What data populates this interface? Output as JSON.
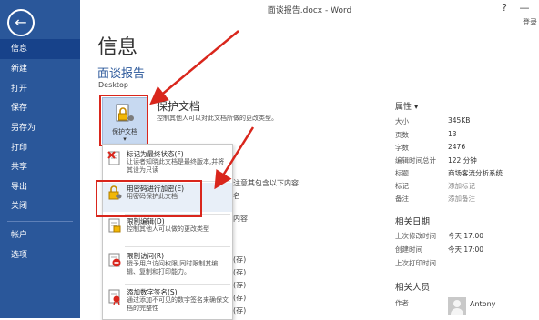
{
  "window": {
    "title": "面谈报告.docx - Word",
    "help": "?",
    "minimize": "—",
    "login": "登录"
  },
  "sidebar": {
    "back": "←",
    "items": [
      {
        "label": "信息"
      },
      {
        "label": "新建"
      },
      {
        "label": "打开"
      },
      {
        "label": "保存"
      },
      {
        "label": "另存为"
      },
      {
        "label": "打印"
      },
      {
        "label": "共享"
      },
      {
        "label": "导出"
      },
      {
        "label": "关闭"
      },
      {
        "label": "帐户"
      },
      {
        "label": "选项"
      }
    ]
  },
  "main": {
    "page_title": "信息",
    "doc_name": "面谈报告",
    "doc_path": "Desktop",
    "protect": {
      "button_label": "保护文档",
      "caret": "▾",
      "title": "保护文档",
      "desc": "控制其他人可以对此文档所做的更改类型。"
    },
    "bg_texts": {
      "a": "注意其包含以下内容:",
      "b": "名",
      "c": "内容",
      "d": "(存)",
      "e": "(存)",
      "f": "(存)",
      "g": "(存)",
      "h": "(存)"
    }
  },
  "menu": {
    "items": [
      {
        "title": "标记为最终状态(F)",
        "desc": "让读者知晓此文档是最终版本,并将其设为只读"
      },
      {
        "title": "用密码进行加密(E)",
        "desc": "用密码保护此文档"
      },
      {
        "title": "限制编辑(D)",
        "desc": "控制其他人可以做的更改类型"
      },
      {
        "title": "限制访问(R)",
        "desc": "授予用户访问权限,同时限制其编辑、复制和打印能力。"
      },
      {
        "title": "添加数字签名(S)",
        "desc": "通过添加不可见的数字签名来确保文档的完整性"
      }
    ]
  },
  "properties": {
    "heading": "属性 ▾",
    "rows": [
      {
        "k": "大小",
        "v": "345KB"
      },
      {
        "k": "页数",
        "v": "13"
      },
      {
        "k": "字数",
        "v": "2476"
      },
      {
        "k": "编辑时间总计",
        "v": "122 分钟"
      },
      {
        "k": "标题",
        "v": "商场客流分析系统"
      },
      {
        "k": "标记",
        "v": "添加标记"
      },
      {
        "k": "备注",
        "v": "添加备注"
      }
    ],
    "dates_heading": "相关日期",
    "dates": [
      {
        "k": "上次修改时间",
        "v": "今天 17:00"
      },
      {
        "k": "创建时间",
        "v": "今天 17:00"
      },
      {
        "k": "上次打印时间",
        "v": ""
      }
    ],
    "people_heading": "相关人员",
    "author_label": "作者",
    "author_name": "Antony"
  },
  "colors": {
    "sidebar": "#2a579a",
    "highlight_box": "#d9261c",
    "accent": "#2a579a"
  }
}
